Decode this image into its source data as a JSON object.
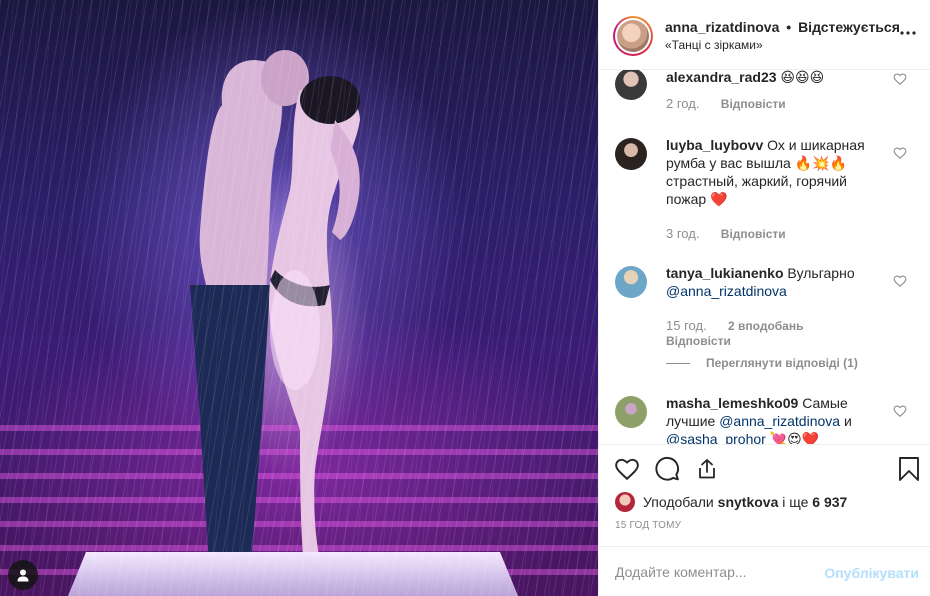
{
  "post": {
    "header": {
      "username": "anna_rizatdinova",
      "separator": "•",
      "follow_status": "Відстежується",
      "location": "«Танці с зірками»",
      "more_icon": "more-horizontal-icon"
    },
    "comments": [
      {
        "username": "alexandra_rad23",
        "text": "😆😆😆",
        "time": "2 год.",
        "reply_label": "Відповісти",
        "likes_label": "",
        "avatar_color": "#3a3a3a"
      },
      {
        "username": "luyba_luybovv",
        "text": "Ох и шикарная румба у вас вышла 🔥💥🔥 страстный, жаркий, горячий пожар ❤️",
        "time": "3 год.",
        "reply_label": "Відповісти",
        "likes_label": "",
        "avatar_color": "#2a2320"
      },
      {
        "username": "tanya_lukianenko",
        "text": "Вульгарно",
        "mention": "@anna_rizatdinova",
        "time": "15 год.",
        "likes_label": "2 вподобань",
        "reply_label": "Відповісти",
        "view_replies": "Переглянути відповіді (1)",
        "avatar_color": "#6da7c7"
      },
      {
        "username": "masha_lemeshko09",
        "text_before": "Самые лучшие",
        "mention1": "@anna_rizatdinova",
        "text_between": "и",
        "mention2": "@sasha_prohor",
        "text_after": "💘😍❤️",
        "avatar_color": "#8ea06a"
      }
    ],
    "actions": {
      "like_icon": "heart-icon",
      "comment_icon": "comment-icon",
      "share_icon": "share-icon",
      "save_icon": "bookmark-icon"
    },
    "likes": {
      "prefix": "Уподобали",
      "user": "snytkova",
      "connector": "і ще",
      "count": "6 937"
    },
    "timestamp": "15 ГОД ТОМУ",
    "add_comment": {
      "placeholder": "Додайте коментар...",
      "publish_label": "Опублікувати"
    }
  },
  "photo": {
    "user_tag_icon": "user-tag-icon",
    "colors": {
      "stage_purple": "#3b1c74",
      "light_pink": "#eb5aeb"
    }
  },
  "colors": {
    "text": "#262626",
    "secondary": "#8e8e8e",
    "mention": "#003569",
    "publish_disabled": "#b2dffc",
    "border": "#efefef"
  }
}
